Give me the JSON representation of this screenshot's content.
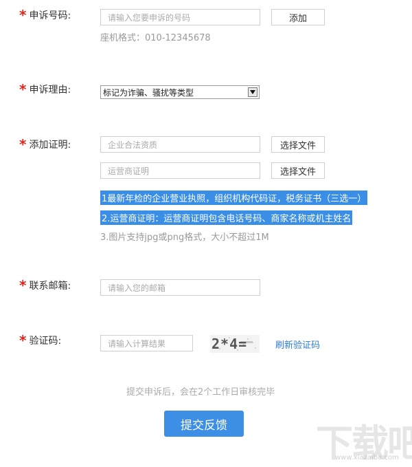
{
  "form": {
    "required_mark": "*",
    "phone": {
      "label": "申诉号码:",
      "placeholder": "请输入您要申诉的号码",
      "add_button": "添加",
      "hint": "座机格式：010-12345678"
    },
    "reason": {
      "label": "申诉理由:",
      "selected": "标记为诈骗、骚扰等类型"
    },
    "proof": {
      "label": "添加证明:",
      "file1_placeholder": "企业合法资质",
      "file2_placeholder": "运营商证明",
      "choose_file": "选择文件",
      "note1": "1最新年检的企业营业执照，组织机构代码证，税务证书（三选一）",
      "note2": "2.运营商证明：运营商证明包含电话号码、商家名称或机主姓名",
      "note3": "3.图片支持jpg或png格式，大小不超过1M"
    },
    "email": {
      "label": "联系邮箱:",
      "placeholder": "请输入您的邮箱"
    },
    "captcha": {
      "label": "验证码:",
      "placeholder": "请输入计算结果",
      "image_text": "2*4=",
      "refresh": "刷新验证码"
    },
    "footer_hint": "提交申诉后，会在2个工作日审核完毕",
    "submit": "提交反馈"
  },
  "watermark": {
    "text": "下载吧",
    "url": "www.xiazaiba.com"
  }
}
